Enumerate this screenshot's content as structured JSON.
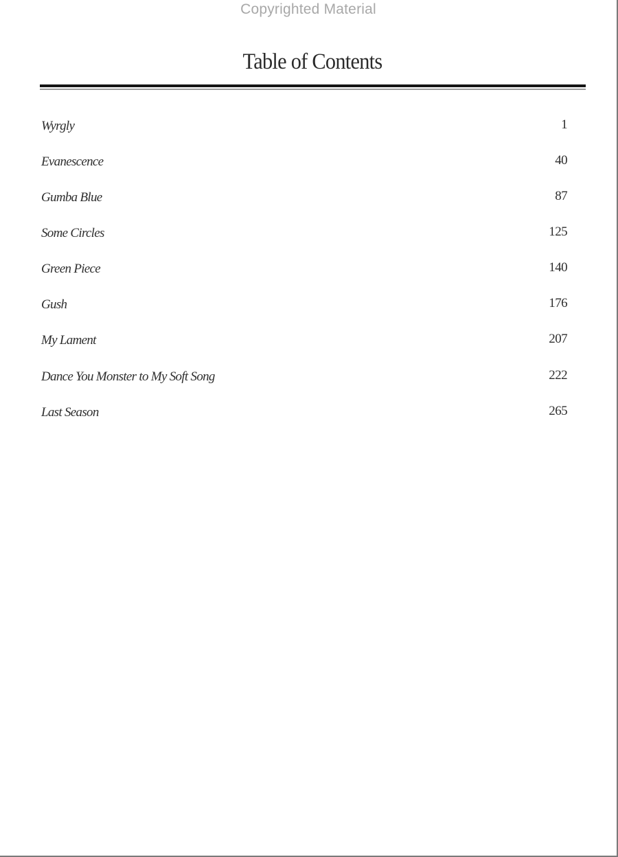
{
  "watermark": "Copyrighted Material",
  "heading": "Table of Contents",
  "entries": [
    {
      "title": "Wyrgly",
      "page": "1"
    },
    {
      "title": "Evanescence",
      "page": "40"
    },
    {
      "title": "Gumba Blue",
      "page": "87"
    },
    {
      "title": "Some Circles",
      "page": "125"
    },
    {
      "title": "Green Piece",
      "page": "140"
    },
    {
      "title": "Gush",
      "page": "176"
    },
    {
      "title": "My Lament",
      "page": "207"
    },
    {
      "title": "Dance You Monster to My Soft Song",
      "page": "222"
    },
    {
      "title": "Last Season",
      "page": "265"
    }
  ]
}
